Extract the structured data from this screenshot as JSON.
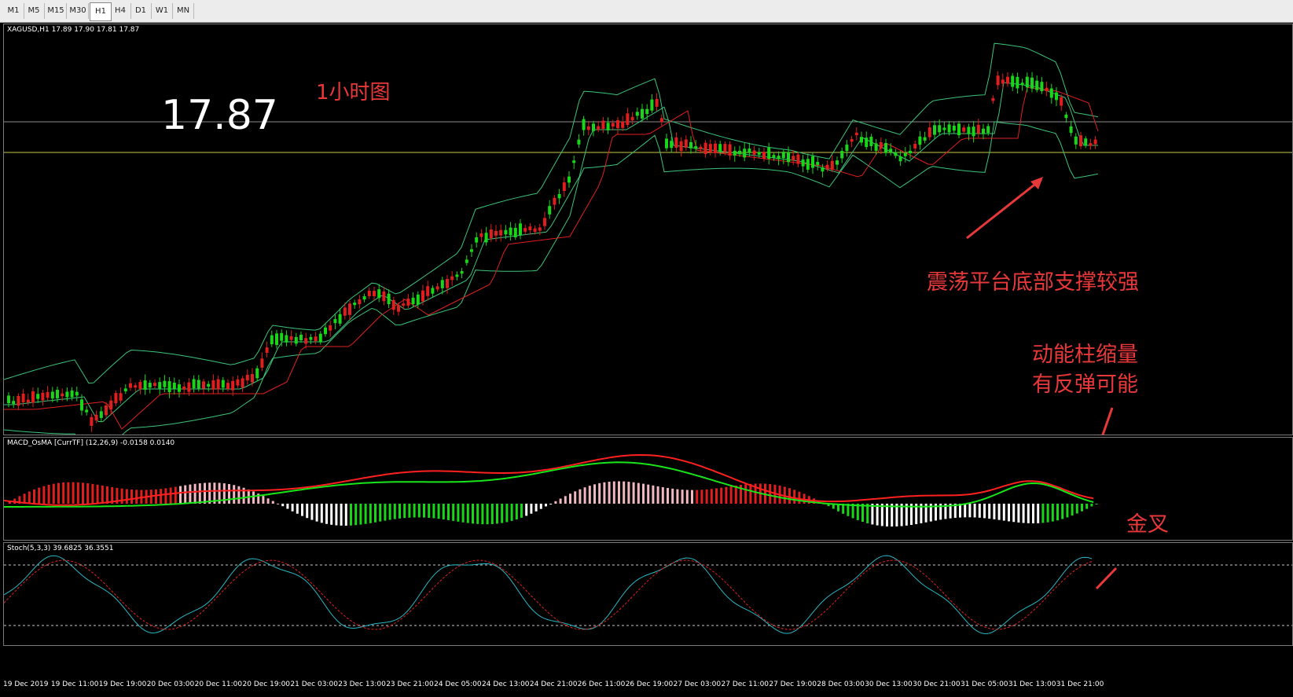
{
  "toolbar": {
    "timeframes": [
      "M1",
      "M5",
      "M15",
      "M30",
      "H1",
      "H4",
      "D1",
      "W1",
      "MN"
    ],
    "active": "H1"
  },
  "main_chart": {
    "header": "XAGUSD,H1  17.89 17.90 17.81 17.87",
    "big_price": "17.87",
    "timeframe_note": "1小时图",
    "annotation_support": "震荡平台底部支撑较强"
  },
  "macd_panel": {
    "header": "MACD_OsMA [CurrTF] (12,26,9) -0.0158 0.0140",
    "annotation_line1": "动能柱缩量",
    "annotation_line2": "有反弹可能",
    "annotation_cross": "金叉"
  },
  "stoch_panel": {
    "header": "Stoch(5,3,3) 39.6825 36.3551"
  },
  "time_axis": [
    "19 Dec 2019",
    "19 Dec 11:00",
    "19 Dec 19:00",
    "20 Dec 03:00",
    "20 Dec 11:00",
    "20 Dec 19:00",
    "21 Dec 03:00",
    "23 Dec 13:00",
    "23 Dec 21:00",
    "24 Dec 05:00",
    "24 Dec 13:00",
    "24 Dec 21:00",
    "26 Dec 11:00",
    "26 Dec 19:00",
    "27 Dec 03:00",
    "27 Dec 11:00",
    "27 Dec 19:00",
    "28 Dec 03:00",
    "30 Dec 13:00",
    "30 Dec 21:00",
    "31 Dec 05:00",
    "31 Dec 13:00",
    "31 Dec 21:00"
  ],
  "colors": {
    "bull": "#19d619",
    "bear": "#e01e1e",
    "annotation": "#e8383a",
    "bollinger": "#3cc47a",
    "ma": "#e02020"
  }
}
